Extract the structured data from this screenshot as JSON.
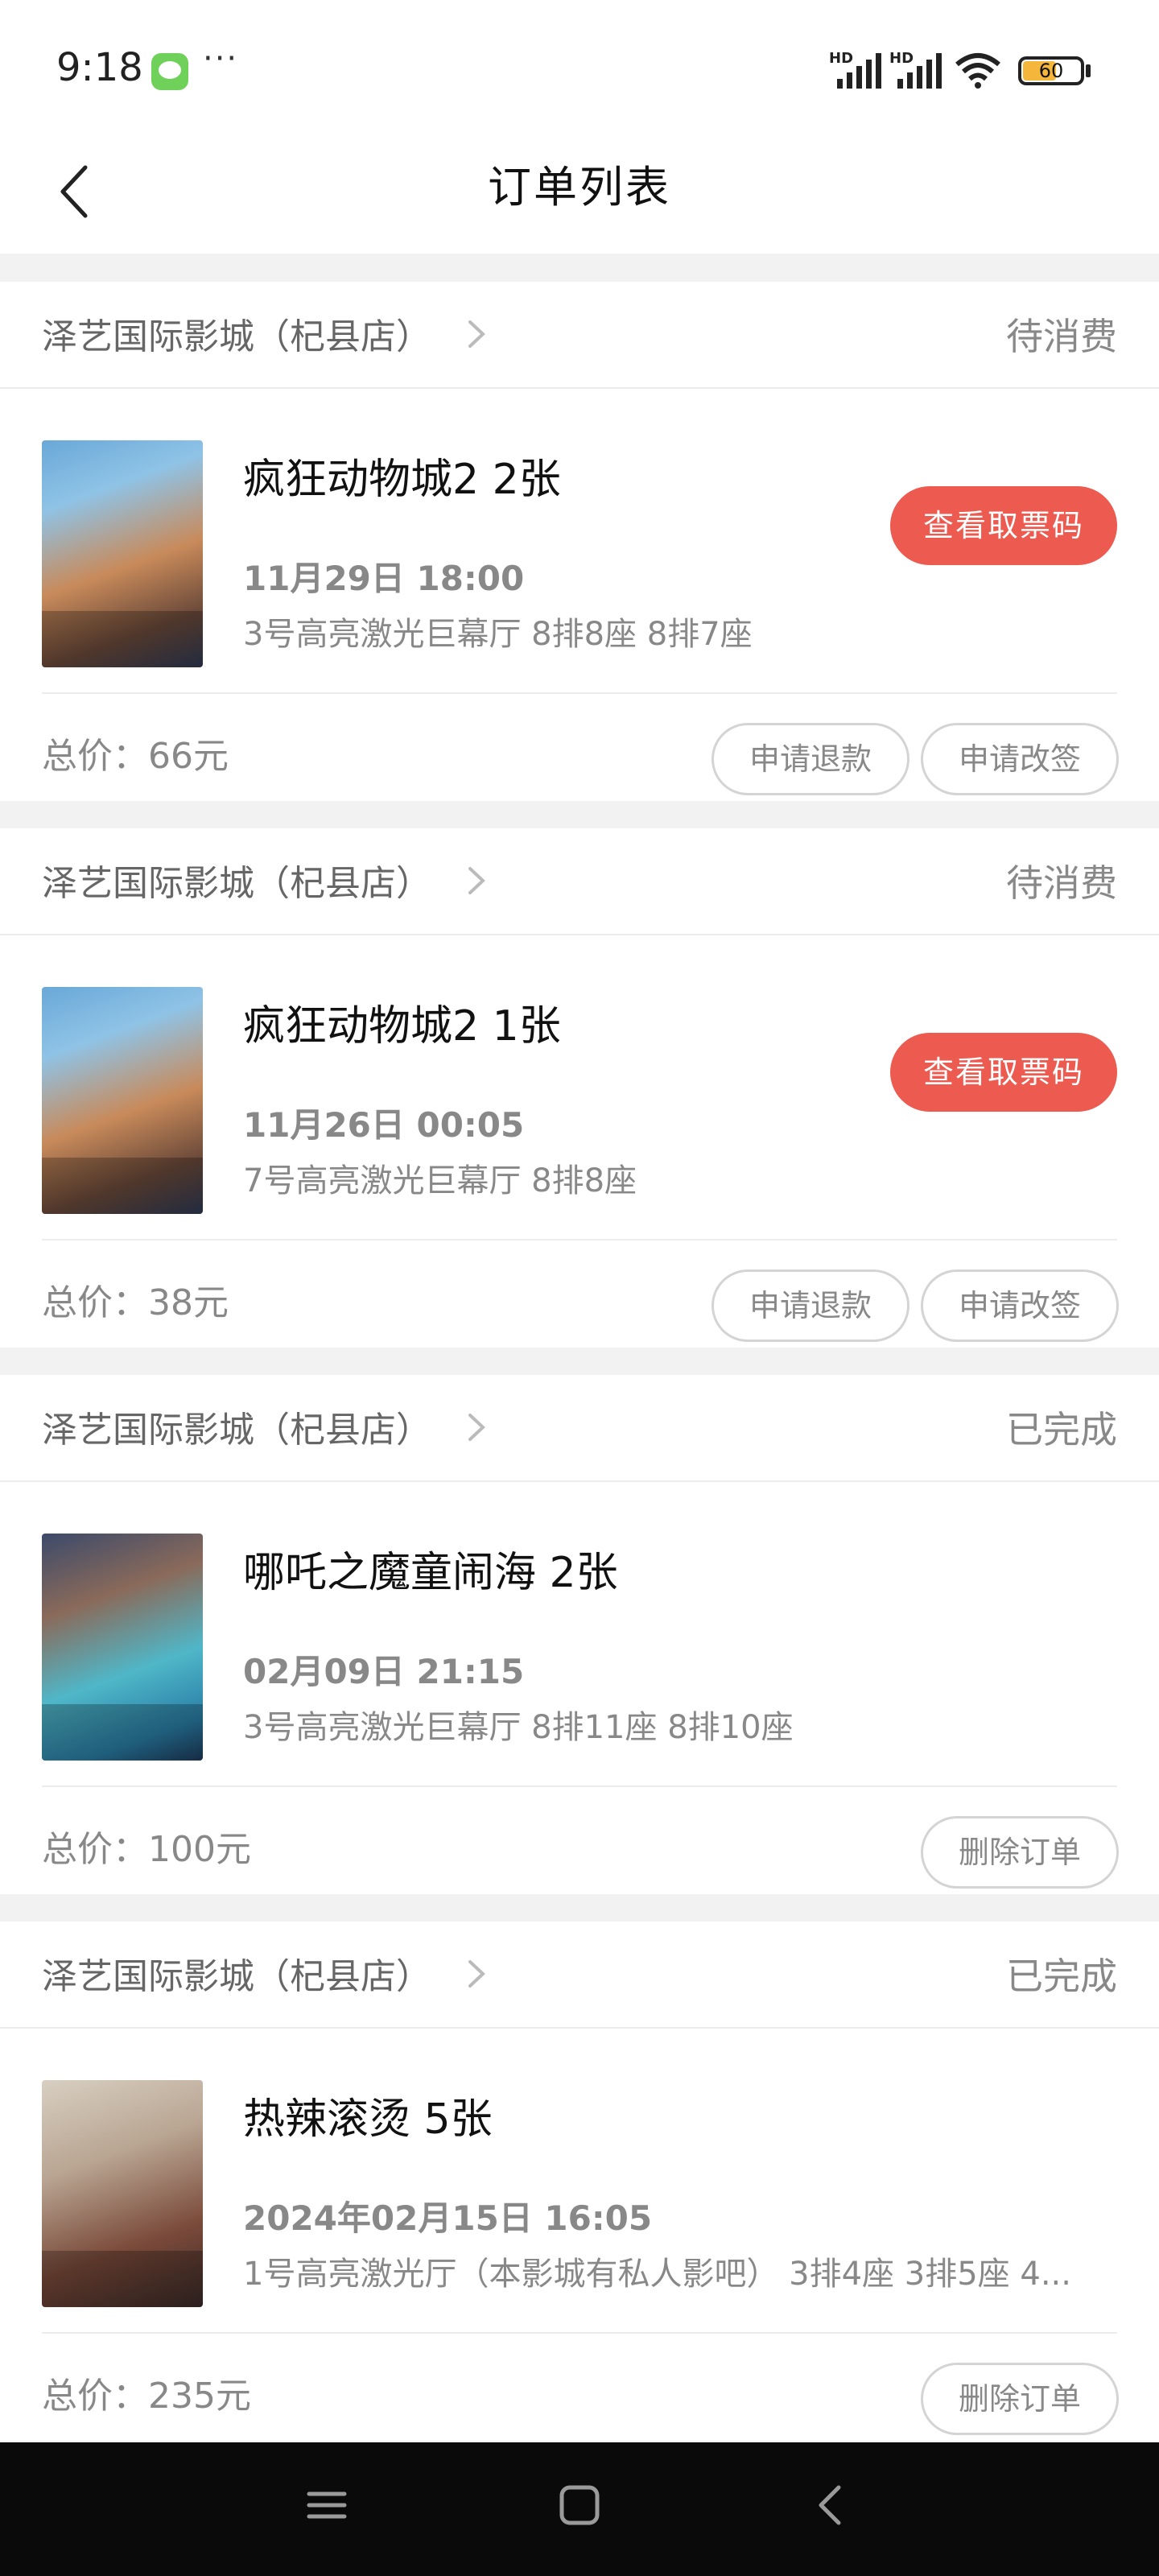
{
  "status_bar": {
    "time": "9:18",
    "dots": "···",
    "signal_label_1": "HD",
    "signal_label_2": "HD",
    "battery_level": "60"
  },
  "header": {
    "title": "订单列表"
  },
  "orders": [
    {
      "cinema": "泽艺国际影城（杞县店）",
      "status": "待消费",
      "title": "疯狂动物城2 2张",
      "showtime": "11月29日 18:00",
      "hall_seats": "3号高亮激光巨幕厅 8排8座 8排7座",
      "ticket_button": "查看取票码",
      "total": "总价：66元",
      "refund_label": "申请退款",
      "change_label": "申请改签"
    },
    {
      "cinema": "泽艺国际影城（杞县店）",
      "status": "待消费",
      "title": "疯狂动物城2 1张",
      "showtime": "11月26日 00:05",
      "hall_seats": "7号高亮激光巨幕厅 8排8座",
      "ticket_button": "查看取票码",
      "total": "总价：38元",
      "refund_label": "申请退款",
      "change_label": "申请改签"
    },
    {
      "cinema": "泽艺国际影城（杞县店）",
      "status": "已完成",
      "title": "哪吒之魔童闹海 2张",
      "showtime": "02月09日 21:15",
      "hall_seats": "3号高亮激光巨幕厅 8排11座 8排10座",
      "total": "总价：100元",
      "delete_label": "删除订单"
    },
    {
      "cinema": "泽艺国际影城（杞县店）",
      "status": "已完成",
      "title": "热辣滚烫 5张",
      "showtime": "2024年02月15日 16:05",
      "hall_seats": "1号高亮激光厅（本影城有私人影吧） 3排4座 3排5座 4...",
      "total": "总价：235元",
      "delete_label": "删除订单"
    }
  ],
  "colors": {
    "accent": "#ec5a50",
    "background": "#f2f2f2",
    "muted_text": "#888888"
  },
  "icons": {
    "back": "chevron-left-icon",
    "cinema_link": "chevron-right-icon",
    "nav_menu": "menu-icon",
    "nav_home": "home-square-icon",
    "nav_back": "back-triangle-icon"
  }
}
